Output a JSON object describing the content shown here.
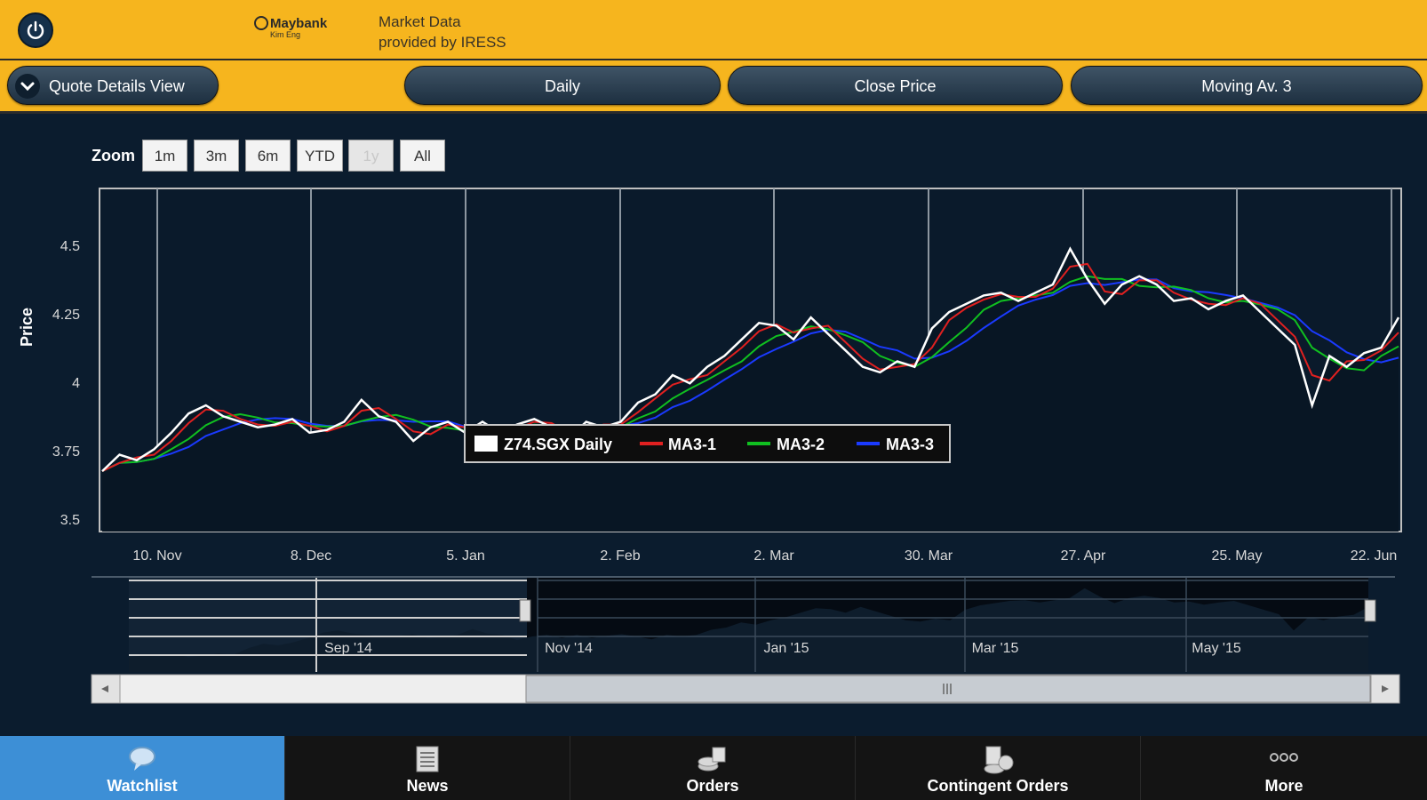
{
  "header": {
    "logo_text": "Maybank",
    "logo_sub": "Kim Eng",
    "market_data_line1": "Market Data",
    "market_data_line2": "provided by IRESS"
  },
  "toolbar": {
    "quote_view": "Quote Details View",
    "period": "Daily",
    "price_type": "Close Price",
    "indicator": "Moving Av. 3"
  },
  "zoom": {
    "label": "Zoom",
    "buttons": [
      "1m",
      "3m",
      "6m",
      "YTD",
      "1y",
      "All"
    ],
    "disabled": "1y"
  },
  "chart_data": {
    "type": "line",
    "ylabel": "Price",
    "ylim": [
      3.5,
      4.75
    ],
    "yticks": [
      "4.5",
      "4.25",
      "4",
      "3.75",
      "3.5"
    ],
    "xticks": [
      "10. Nov",
      "8. Dec",
      "5. Jan",
      "2. Feb",
      "2. Mar",
      "30. Mar",
      "27. Apr",
      "25. May",
      "22. Jun"
    ],
    "legend": [
      "Z74.SGX Daily",
      "MA3-1",
      "MA3-2",
      "MA3-3"
    ],
    "legend_placement": "bottom-center",
    "series_colors": [
      "#ffffff",
      "#e02020",
      "#10c020",
      "#1a3aff"
    ],
    "price_series": [
      3.72,
      3.78,
      3.76,
      3.8,
      3.86,
      3.93,
      3.96,
      3.92,
      3.9,
      3.88,
      3.89,
      3.91,
      3.86,
      3.87,
      3.9,
      3.98,
      3.92,
      3.9,
      3.83,
      3.88,
      3.9,
      3.86,
      3.9,
      3.86,
      3.89,
      3.91,
      3.88,
      3.84,
      3.9,
      3.88,
      3.9,
      3.97,
      4.0,
      4.07,
      4.04,
      4.1,
      4.14,
      4.2,
      4.26,
      4.25,
      4.2,
      4.28,
      4.22,
      4.16,
      4.1,
      4.08,
      4.12,
      4.1,
      4.24,
      4.3,
      4.33,
      4.36,
      4.37,
      4.34,
      4.37,
      4.4,
      4.53,
      4.42,
      4.33,
      4.4,
      4.43,
      4.4,
      4.34,
      4.35,
      4.31,
      4.34,
      4.36,
      4.3,
      4.24,
      4.18,
      3.96,
      4.14,
      4.1,
      4.15,
      4.17,
      4.28
    ],
    "navigator_ticks": [
      "Sep '14",
      "Nov '14",
      "Jan '15",
      "Mar '15",
      "May '15"
    ]
  },
  "nav": {
    "items": [
      "Watchlist",
      "News",
      "Orders",
      "Contingent Orders",
      "More"
    ],
    "active": "Watchlist"
  }
}
